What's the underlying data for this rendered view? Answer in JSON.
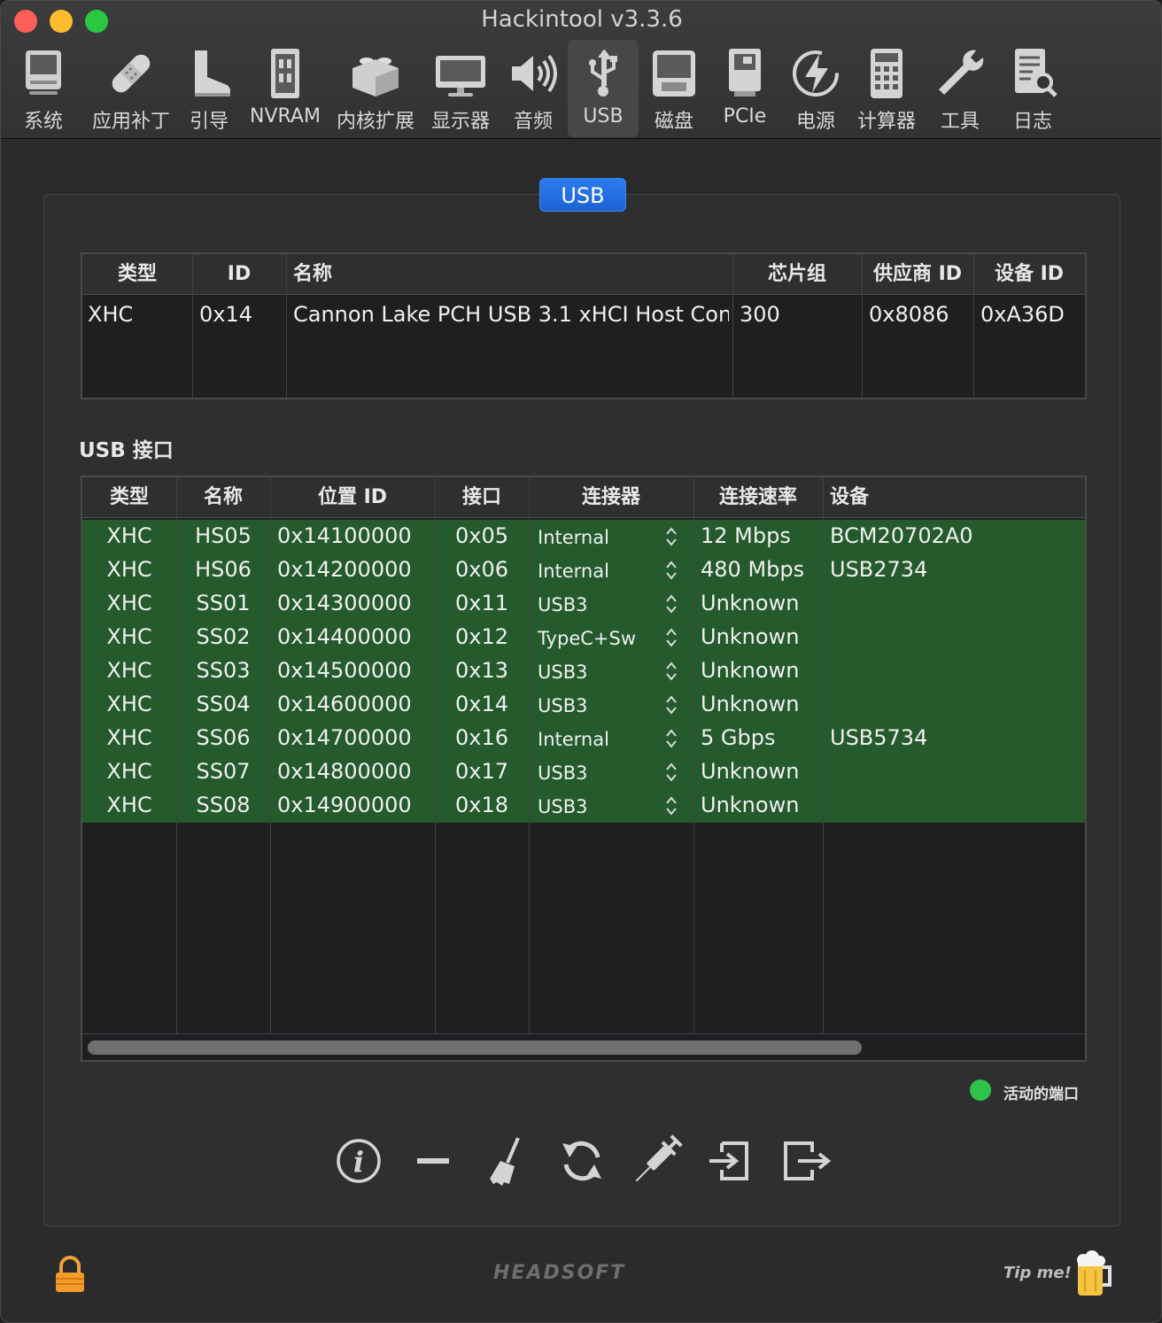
{
  "window": {
    "title": "Hackintool v3.3.6"
  },
  "toolbar": {
    "items": [
      {
        "label": "系统",
        "icon": "computer-icon"
      },
      {
        "label": "应用补丁",
        "icon": "bandage-icon"
      },
      {
        "label": "引导",
        "icon": "boot-icon"
      },
      {
        "label": "NVRAM",
        "icon": "memory-chip-icon"
      },
      {
        "label": "内核扩展",
        "icon": "lego-brick-icon"
      },
      {
        "label": "显示器",
        "icon": "monitor-icon"
      },
      {
        "label": "音频",
        "icon": "speaker-icon"
      },
      {
        "label": "USB",
        "icon": "usb-icon",
        "active": true
      },
      {
        "label": "磁盘",
        "icon": "disk-icon"
      },
      {
        "label": "PCIe",
        "icon": "pcie-card-icon"
      },
      {
        "label": "电源",
        "icon": "power-bolt-icon"
      },
      {
        "label": "计算器",
        "icon": "calculator-icon"
      },
      {
        "label": "工具",
        "icon": "wrench-icon"
      },
      {
        "label": "日志",
        "icon": "log-search-icon"
      }
    ]
  },
  "tab": {
    "label": "USB"
  },
  "controllers": {
    "headers": [
      "类型",
      "ID",
      "名称",
      "芯片组",
      "供应商 ID",
      "设备 ID"
    ],
    "rows": [
      [
        "XHC",
        "0x14",
        "Cannon Lake PCH USB 3.1 xHCI Host Con...",
        "300",
        "0x8086",
        "0xA36D"
      ]
    ]
  },
  "ports_section": {
    "title": "USB 接口"
  },
  "ports": {
    "headers": [
      "类型",
      "名称",
      "位置 ID",
      "接口",
      "连接器",
      "连接速率",
      "设备"
    ],
    "rows": [
      [
        "XHC",
        "HS05",
        "0x14100000",
        "0x05",
        "Internal",
        "12 Mbps",
        "BCM20702A0"
      ],
      [
        "XHC",
        "HS06",
        "0x14200000",
        "0x06",
        "Internal",
        "480 Mbps",
        "USB2734"
      ],
      [
        "XHC",
        "SS01",
        "0x14300000",
        "0x11",
        "USB3",
        "Unknown",
        ""
      ],
      [
        "XHC",
        "SS02",
        "0x14400000",
        "0x12",
        "TypeC+Sw",
        "Unknown",
        ""
      ],
      [
        "XHC",
        "SS03",
        "0x14500000",
        "0x13",
        "USB3",
        "Unknown",
        ""
      ],
      [
        "XHC",
        "SS04",
        "0x14600000",
        "0x14",
        "USB3",
        "Unknown",
        ""
      ],
      [
        "XHC",
        "SS06",
        "0x14700000",
        "0x16",
        "Internal",
        "5 Gbps",
        "USB5734"
      ],
      [
        "XHC",
        "SS07",
        "0x14800000",
        "0x17",
        "USB3",
        "Unknown",
        ""
      ],
      [
        "XHC",
        "SS08",
        "0x14900000",
        "0x18",
        "USB3",
        "Unknown",
        ""
      ]
    ],
    "active_row_color": "#245a2c"
  },
  "legend": {
    "label": "活动的端口",
    "color": "#2ec44a"
  },
  "actions": [
    {
      "name": "info-icon"
    },
    {
      "name": "remove-icon"
    },
    {
      "name": "broom-icon"
    },
    {
      "name": "refresh-icon"
    },
    {
      "name": "syringe-icon"
    },
    {
      "name": "import-icon"
    },
    {
      "name": "export-icon"
    }
  ],
  "footer": {
    "brand": "HEADSOFT",
    "tip": "Tip me!"
  },
  "colors": {
    "accent": "#1d63d4",
    "active_port": "#245a2c"
  }
}
